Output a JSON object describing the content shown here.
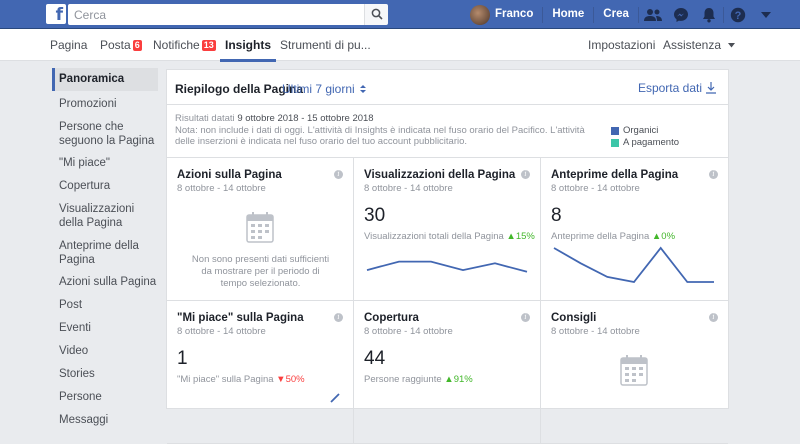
{
  "topbar": {
    "search_placeholder": "Cerca",
    "user_name": "Franco",
    "home_label": "Home",
    "create_label": "Crea",
    "icons": [
      "friends-icon",
      "messenger-icon",
      "notifications-icon",
      "help-icon",
      "dropdown-icon"
    ]
  },
  "pagenav": {
    "tabs": [
      {
        "label": "Pagina"
      },
      {
        "label": "Posta",
        "badge": "6"
      },
      {
        "label": "Notifiche",
        "badge": "13"
      },
      {
        "label": "Insights"
      },
      {
        "label": "Strumenti di pu..."
      }
    ],
    "settings_label": "Impostazioni",
    "help_label": "Assistenza"
  },
  "sidebar": {
    "items": [
      {
        "label": "Panoramica"
      },
      {
        "label": "Promozioni"
      },
      {
        "label": "Persone che seguono la Pagina"
      },
      {
        "label": "\"Mi piace\""
      },
      {
        "label": "Copertura"
      },
      {
        "label": "Visualizzazioni della Pagina"
      },
      {
        "label": "Anteprime della Pagina"
      },
      {
        "label": "Azioni sulla Pagina"
      },
      {
        "label": "Post"
      },
      {
        "label": "Eventi"
      },
      {
        "label": "Video"
      },
      {
        "label": "Stories"
      },
      {
        "label": "Persone"
      },
      {
        "label": "Messaggi"
      }
    ]
  },
  "main": {
    "title": "Riepilogo della Pagina",
    "period": "Ultimi 7 giorni",
    "export_label": "Esporta dati",
    "results_prefix": "Risultati datati ",
    "results_range": "9 ottobre 2018 - 15 ottobre 2018",
    "note": "Nota: non include i dati di oggi. L'attività di Insights è indicata nel fuso orario del Pacifico. L'attività delle inserzioni è indicata nel fuso orario del tuo account pubblicitario.",
    "legend": [
      {
        "label": "Organici",
        "color": "#4267b2"
      },
      {
        "label": "A pagamento",
        "color": "#3cc6a8"
      }
    ]
  },
  "cards": [
    {
      "title": "Azioni sulla Pagina",
      "date": "8 ottobre - 14 ottobre",
      "empty": "Non sono presenti dati sufficienti da mostrare per il periodo di tempo selezionato."
    },
    {
      "title": "Visualizzazioni della Pagina",
      "date": "8 ottobre - 14 ottobre",
      "value": "30",
      "metric": "Visualizzazioni totali della Pagina",
      "change": "15%",
      "trend": "up",
      "spark": [
        0.35,
        0.6,
        0.6,
        0.35,
        0.55,
        0.3
      ]
    },
    {
      "title": "Anteprime della Pagina",
      "date": "8 ottobre - 14 ottobre",
      "value": "8",
      "metric": "Anteprime della Pagina",
      "change": "0%",
      "trend": "up",
      "spark": [
        1.0,
        0.55,
        0.15,
        0.0,
        1.0,
        0.0,
        0.0
      ]
    },
    {
      "title": "\"Mi piace\" sulla Pagina",
      "date": "8 ottobre - 14 ottobre",
      "value": "1",
      "metric": "\"Mi piace\" sulla Pagina",
      "change": "50%",
      "trend": "down"
    },
    {
      "title": "Copertura",
      "date": "8 ottobre - 14 ottobre",
      "value": "44",
      "metric": "Persone raggiunte",
      "change": "91%",
      "trend": "up"
    },
    {
      "title": "Consigli",
      "date": "8 ottobre - 14 ottobre"
    }
  ],
  "info_glyph": "i"
}
